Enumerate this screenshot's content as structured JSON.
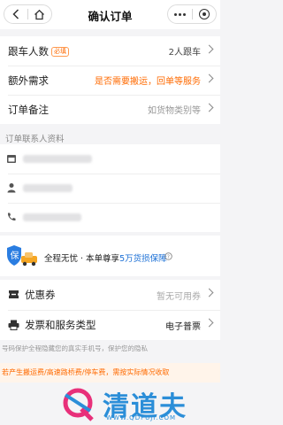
{
  "topbar": {
    "title": "确认订单"
  },
  "order": {
    "rows": [
      {
        "label": "跟车人数",
        "tag": "必填",
        "value": "2人跟车"
      },
      {
        "label": "额外需求",
        "value": "是否需要搬运，回单等服务"
      },
      {
        "label": "订单备注",
        "value": "如货物类别等"
      }
    ],
    "accent_value_color": "#ff6a00"
  },
  "contact": {
    "section_title": "订单联系人资料",
    "rows": [
      {
        "icon": "calendar-icon"
      },
      {
        "icon": "person-icon"
      },
      {
        "icon": "phone-icon"
      }
    ]
  },
  "promo": {
    "text_prefix": "全程无忧 · 本单尊享",
    "text_highlight": "5万货损保障",
    "icon": "shield-insurance-icon",
    "highlight_color": "#1a6fd6"
  },
  "coupon": {
    "label": "优惠券",
    "value": "暂无可用券",
    "icon": "coupon-icon"
  },
  "invoice": {
    "label": "发票和服务类型",
    "value": "电子普票",
    "icon": "printer-icon"
  },
  "footnote": "号码保护全程隐藏您的真实手机号，保护您的隐私",
  "notice": "若产生搬运费/高速路桥费/停车费，需按实际情况收取",
  "watermark": {
    "text": "清道夫",
    "url": "WWW.QDFUJI.COM"
  }
}
